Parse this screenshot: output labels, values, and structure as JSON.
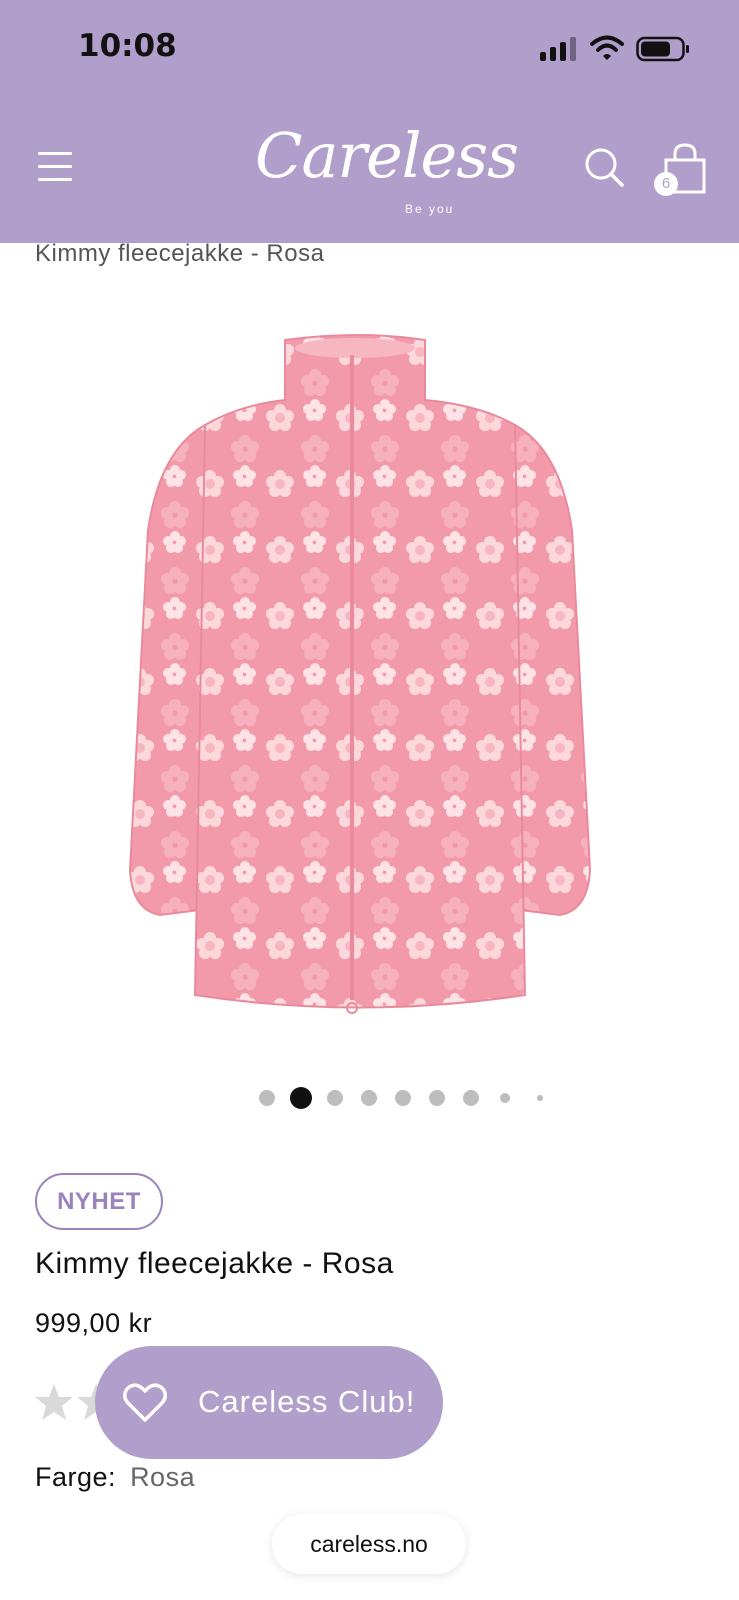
{
  "status_bar": {
    "time": "10:08",
    "icons": [
      "signal-icon",
      "wifi-icon",
      "battery-icon"
    ]
  },
  "header": {
    "background": "#b19fcb",
    "logo_text": "Careless",
    "logo_tagline": "Be you",
    "cart_count": "6",
    "icons": [
      "menu-icon",
      "search-icon",
      "shopping-bag-icon"
    ]
  },
  "breadcrumb": {
    "title": "Kimmy fleecejakke - Rosa"
  },
  "gallery": {
    "image_icon": "pink-floral-fleece-jacket",
    "slide_count": 9,
    "active_index": 1
  },
  "product": {
    "badge": "NYHET",
    "title": "Kimmy fleecejakke - Rosa",
    "price": "999,00 kr",
    "color_label": "Farge:",
    "color_value": "Rosa",
    "rating_icon": "star-icon"
  },
  "club_button": {
    "label": "Careless Club!",
    "icon": "heart-icon"
  },
  "browser": {
    "url": "careless.no"
  },
  "colors": {
    "accent": "#b19fcb",
    "badge_border": "#9a83bd",
    "jacket_pink": "#f29aaa",
    "flower_light": "#fcd8dd"
  }
}
